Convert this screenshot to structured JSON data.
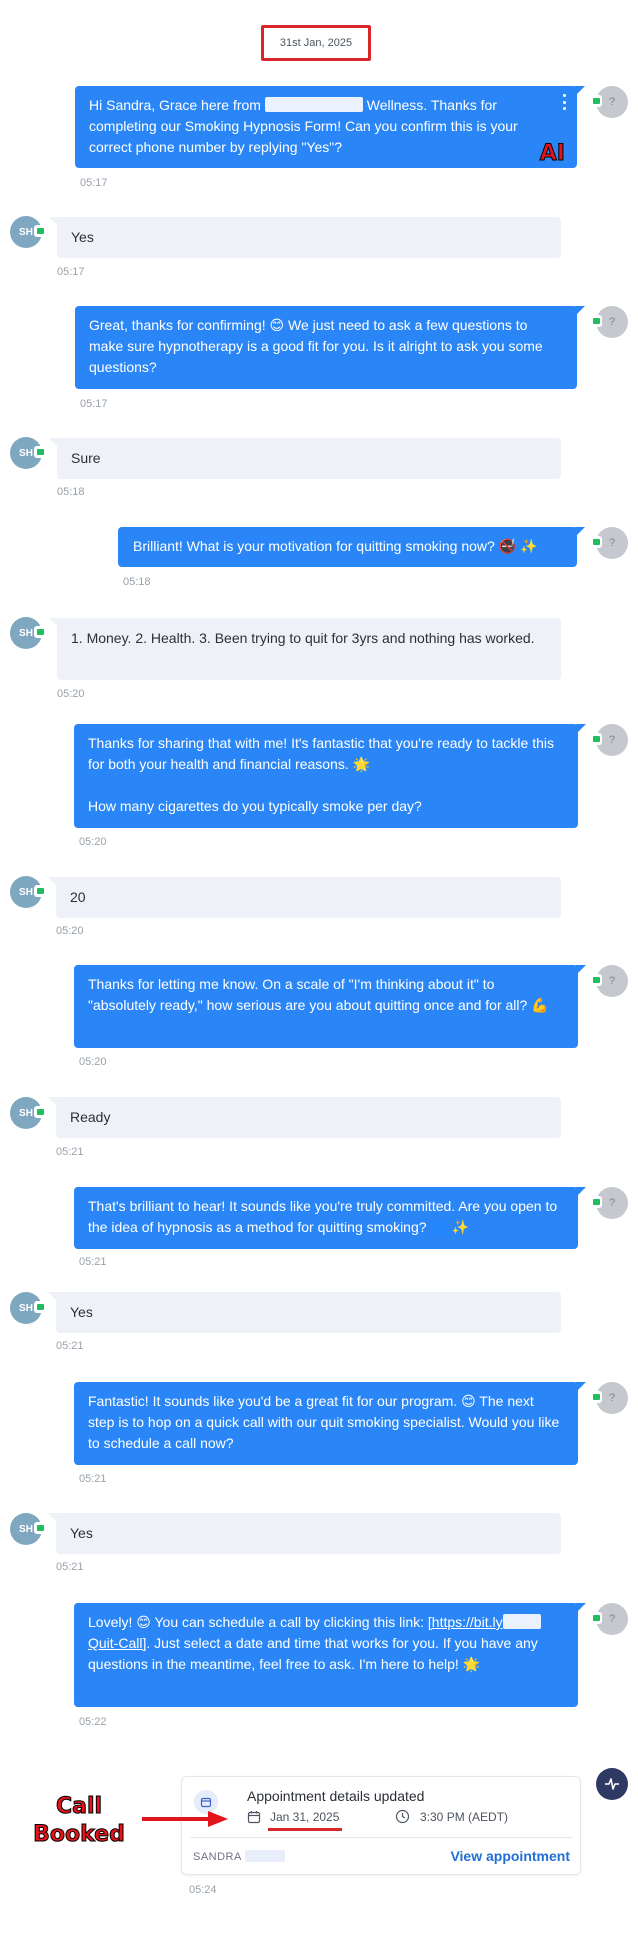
{
  "date_badge": "31st Jan, 2025",
  "agent_avatar": "?",
  "contact_initials": "SH",
  "ai_label": "AI",
  "messages": [
    {
      "dir": "out",
      "text_parts": [
        "Hi Sandra, Grace here from ",
        "[redacted]",
        " Wellness. Thanks for completing our Smoking Hypnosis Form! Can you confirm this is your correct phone number by replying \"Yes\"?"
      ],
      "time": "05:17"
    },
    {
      "dir": "in",
      "text": "Yes",
      "time": "05:17"
    },
    {
      "dir": "out",
      "text": "Great, thanks for confirming! 😊 We just need to ask a few questions to make sure hypnotherapy is a good fit for you. Is it alright to ask you some questions?",
      "time": "05:17"
    },
    {
      "dir": "in",
      "text": "Sure",
      "time": "05:18"
    },
    {
      "dir": "out",
      "text": "Brilliant! What is your motivation for quitting smoking now? 🚭 ✨",
      "time": "05:18"
    },
    {
      "dir": "in",
      "text": "1. Money. 2. Health. 3. Been trying to quit for 3yrs and nothing has worked.",
      "time": "05:20"
    },
    {
      "dir": "out",
      "text": "Thanks for sharing that with me! It's fantastic that you're ready to tackle this for both your health and financial reasons. 🌟",
      "text2": "How many cigarettes do you typically smoke per day?",
      "time": "05:20"
    },
    {
      "dir": "in",
      "text": "20",
      "time": "05:20"
    },
    {
      "dir": "out",
      "text": "Thanks for letting me know. On a scale of \"I'm thinking about it\" to \"absolutely ready,\" how serious are you about quitting once and for all? 💪",
      "time": "05:20"
    },
    {
      "dir": "in",
      "text": "Ready",
      "time": "05:21"
    },
    {
      "dir": "out",
      "text": "That's brilliant to hear! It sounds like you're truly committed. Are you open to the idea of hypnosis as a method for quitting smoking? 🌀 ✨",
      "time": "05:21"
    },
    {
      "dir": "in",
      "text": "Yes",
      "time": "05:21"
    },
    {
      "dir": "out",
      "text": "Fantastic! It sounds like you'd be a great fit for our program. 😊 The next step is to hop on a quick call with our quit smoking specialist. Would you like to schedule a call now?",
      "time": "05:21"
    },
    {
      "dir": "in",
      "text": "Yes",
      "time": "05:21"
    },
    {
      "dir": "out",
      "link_prefix": "Lovely! 😊 You can schedule a call by clicking this link: ",
      "link_a": "[https://bit.ly",
      "link_b": "Quit-Call]",
      "link_suffix": ". Just select a date and time that works for you. If you have any questions in the meantime, feel free to ask. I'm here to help! 🌟",
      "time": "05:22"
    }
  ],
  "appointment": {
    "title": "Appointment details updated",
    "date": "Jan 31, 2025",
    "time": "3:30 PM (AEDT)",
    "contact": "SANDRA",
    "link_label": "View appointment",
    "timestamp": "05:24"
  },
  "annotation": {
    "line1": "Call",
    "line2": "Booked",
    "color": "#e3141c"
  },
  "colors": {
    "outgoing": "#2a86f7",
    "incoming": "#eff1f8",
    "accent_link": "#1f6fd6",
    "annotation": "#d9262a"
  }
}
